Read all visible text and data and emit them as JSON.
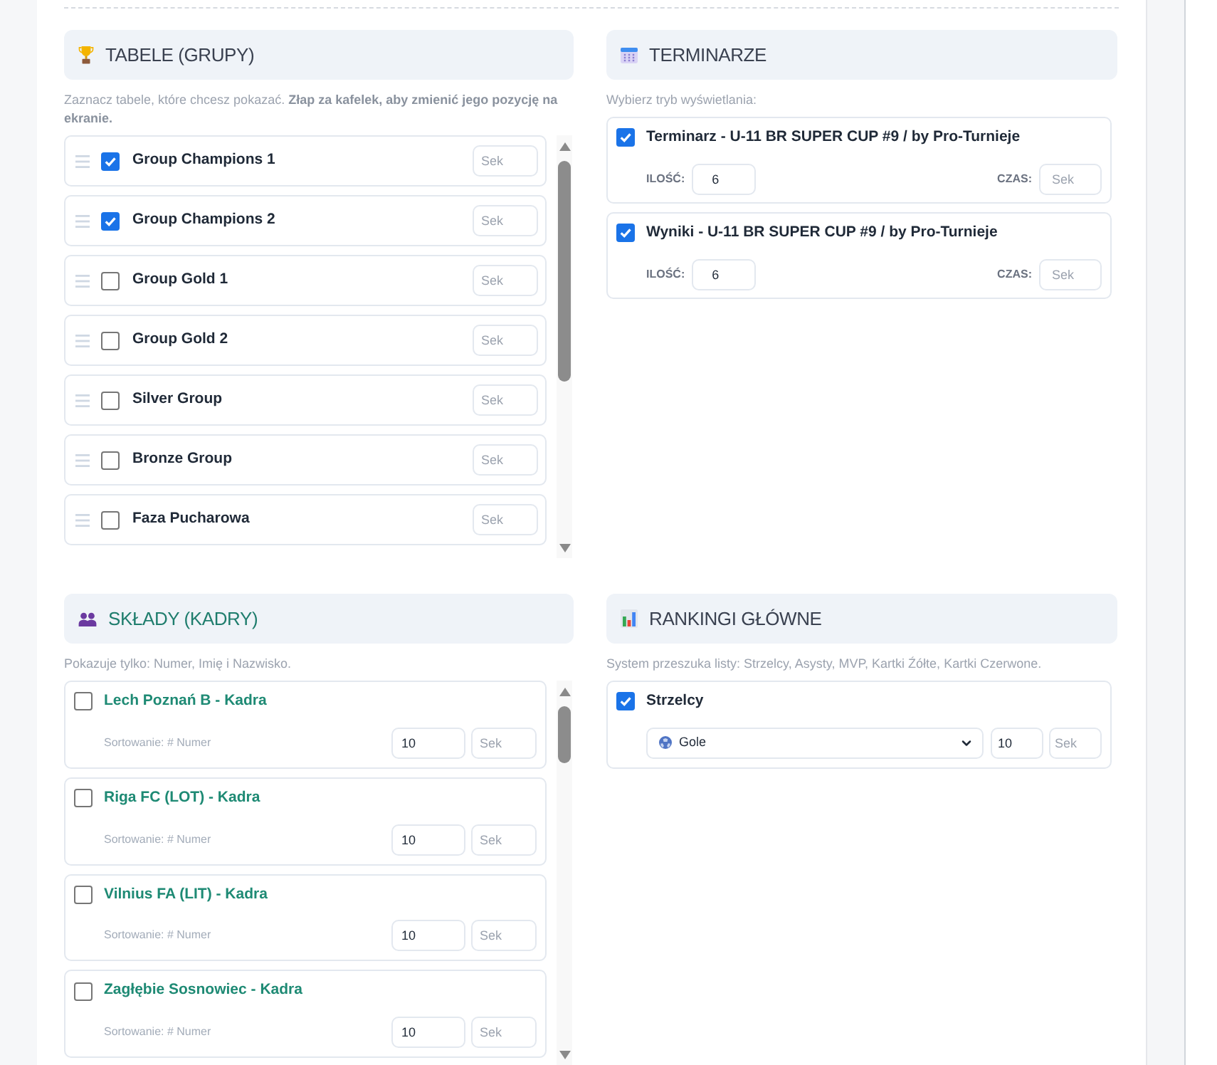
{
  "panels": [
    {
      "kind": "tables",
      "title": "TABELE (GRUPY)",
      "hint": "Zaznacz tabele, które chcesz pokazać. **Złap za kafelek, aby zmienić jego pozycję na ekranie.**",
      "items": [
        {
          "label": "Group Champions 1",
          "checked": true,
          "time_placeholder": "Sek"
        },
        {
          "label": "Group Champions 2",
          "checked": true,
          "time_placeholder": "Sek"
        },
        {
          "label": "Group Gold 1",
          "checked": false,
          "time_placeholder": "Sek"
        },
        {
          "label": "Group Gold 2",
          "checked": false,
          "time_placeholder": "Sek"
        },
        {
          "label": "Silver Group",
          "checked": false,
          "time_placeholder": "Sek"
        },
        {
          "label": "Bronze Group",
          "checked": false,
          "time_placeholder": "Sek"
        },
        {
          "label": "Faza Pucharowa",
          "checked": false,
          "time_placeholder": "Sek"
        }
      ]
    },
    {
      "kind": "schedules",
      "title": "TERMINARZE",
      "hint": "Wybierz tryb wyświetlania:",
      "items": [
        {
          "label": "Terminarz - U-11 BR SUPER CUP #9 / by Pro-Turnieje",
          "checked": true,
          "count_label": "ILOŚĆ:",
          "count_value": "6",
          "time_label": "CZAS:",
          "time_placeholder": "Sek"
        },
        {
          "label": "Wyniki - U-11 BR SUPER CUP #9 / by Pro-Turnieje",
          "checked": true,
          "count_label": "ILOŚĆ:",
          "count_value": "6",
          "time_label": "CZAS:",
          "time_placeholder": "Sek"
        }
      ]
    },
    {
      "kind": "squads",
      "title": "SKŁADY (KADRY)",
      "hint": "Pokazuje tylko: Numer, Imię i Nazwisko.",
      "items": [
        {
          "label": "Lech Poznań B - Kadra",
          "checked": false,
          "sort_label": "Sortowanie: # Numer",
          "count_value": "10",
          "time_placeholder": "Sek"
        },
        {
          "label": "Riga FC (LOT) - Kadra",
          "checked": false,
          "sort_label": "Sortowanie: # Numer",
          "count_value": "10",
          "time_placeholder": "Sek"
        },
        {
          "label": "Vilnius FA (LIT) - Kadra",
          "checked": false,
          "sort_label": "Sortowanie: # Numer",
          "count_value": "10",
          "time_placeholder": "Sek"
        },
        {
          "label": "Zagłębie Sosnowiec - Kadra",
          "checked": false,
          "sort_label": "Sortowanie: # Numer",
          "count_value": "10",
          "time_placeholder": "Sek"
        }
      ]
    },
    {
      "kind": "rankings",
      "title": "RANKINGI GŁÓWNE",
      "hint": "System przeszuka listy: Strzelcy, Asysty, MVP, Kartki Źółte, Kartki Czerwone.",
      "items": [
        {
          "label": "Strzelcy",
          "checked": true,
          "select_value": "Gole",
          "count_value": "10",
          "time_placeholder": "Sek"
        }
      ]
    }
  ]
}
